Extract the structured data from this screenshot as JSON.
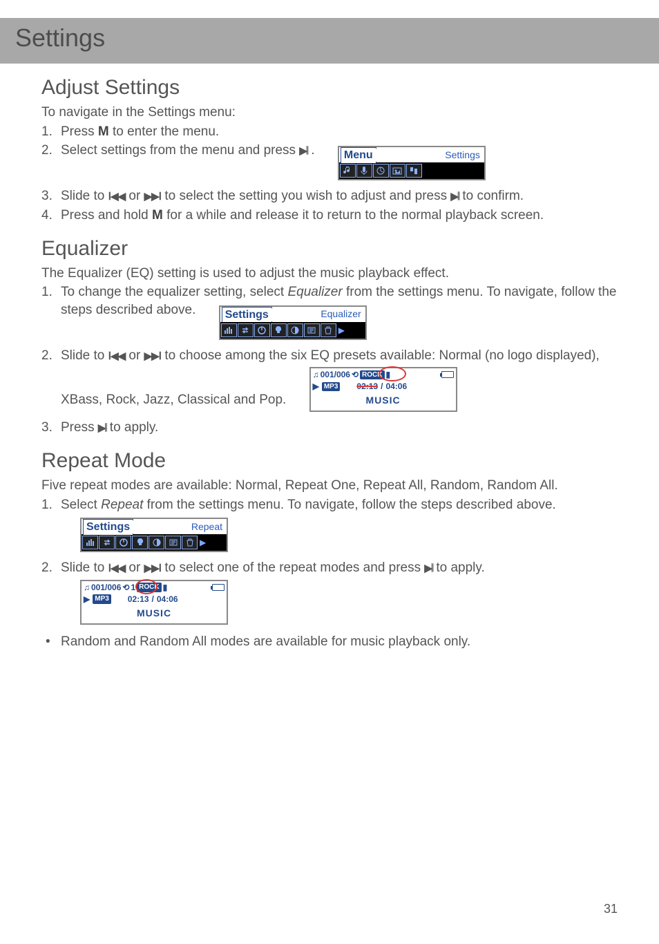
{
  "pageNumber": "31",
  "title": "Settings",
  "adjust": {
    "heading": "Adjust Settings",
    "intro": "To navigate in the Settings menu:",
    "step1_a": "Press ",
    "step1_m": "M",
    "step1_b": " to enter the menu.",
    "step2_a": "Select settings from the menu and press ",
    "step2_b": " .",
    "lcd_tab": "Menu",
    "lcd_label": "Settings",
    "step3_a": "Slide to ",
    "step3_b": " or ",
    "step3_c": " to select the setting you wish to adjust and press ",
    "step3_d": " to confirm.",
    "step4_a": "Press and hold ",
    "step4_m": "M",
    "step4_b": " for a while and release it to return to the normal playback screen."
  },
  "eq": {
    "heading": "Equalizer",
    "intro": "The Equalizer (EQ) setting is used to adjust the music playback effect.",
    "step1_a": "To change the equalizer setting, select ",
    "step1_i": "Equalizer",
    "step1_b": " from the settings menu. To navigate, follow the steps described above.",
    "lcd_tab": "Settings",
    "lcd_label": "Equalizer",
    "step2_a": "Slide to ",
    "step2_b": " or ",
    "step2_c": " to choose among the six EQ presets available: Normal (no logo displayed), XBass, Rock, Jazz, Classical and Pop.",
    "play_count": "001/006",
    "play_badge": "ROCK",
    "play_mp3": "MP3",
    "play_time_a": "02:13",
    "play_time_b": "04:06",
    "play_title": "MUSIC",
    "step3_a": "Press ",
    "step3_b": " to apply."
  },
  "repeat": {
    "heading": "Repeat Mode",
    "intro": "Five repeat modes are available: Normal, Repeat One, Repeat All, Random, Random All.",
    "step1_a": "Select ",
    "step1_i": "Repeat",
    "step1_b": " from the settings menu. To navigate, follow the steps described above.",
    "lcd_tab": "Settings",
    "lcd_label": "Repeat",
    "step2_a": "Slide to ",
    "step2_b": " or ",
    "step2_c": " to select one of the repeat modes and press ",
    "step2_d": " to apply.",
    "play_count": "001/006",
    "play_badge": "ROCK",
    "play_badge_pre": "1",
    "play_mp3": "MP3",
    "play_time_a": "02:13",
    "play_time_b": "04:06",
    "play_title": "MUSIC",
    "note": "Random and Random All modes are available for music playback only."
  },
  "glyphs": {
    "playpause": "▶𝄁",
    "prev": "ꓲ◀◀",
    "next": "▶▶ꓲ",
    "play_small": "▶",
    "note": "♫"
  }
}
